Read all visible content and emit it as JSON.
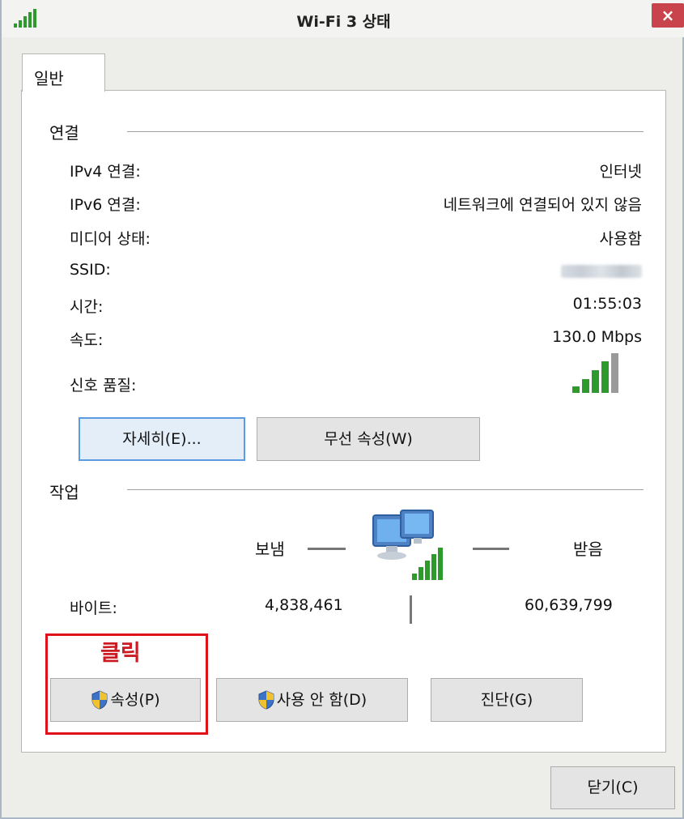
{
  "window": {
    "title": "Wi-Fi 3 상태",
    "close_label": "×"
  },
  "tabs": [
    {
      "label": "일반"
    }
  ],
  "connection": {
    "title": "연결",
    "rows": [
      {
        "label": "IPv4 연결:",
        "value": "인터넷"
      },
      {
        "label": "IPv6 연결:",
        "value": "네트워크에 연결되어 있지 않음"
      },
      {
        "label": "미디어 상태:",
        "value": "사용함"
      },
      {
        "label": "SSID:",
        "value": ""
      },
      {
        "label": "시간:",
        "value": "01:55:03"
      },
      {
        "label": "속도:",
        "value": "130.0 Mbps"
      },
      {
        "label": "신호 품질:",
        "value": ""
      }
    ],
    "signal_bars_filled": 4,
    "signal_bars_total": 5,
    "details_button": "자세히(E)...",
    "wireless_props_button": "무선 속성(W)"
  },
  "activity": {
    "title": "작업",
    "sent_label": "보냄",
    "received_label": "받음",
    "bytes_label": "바이트:",
    "bytes_sent": "4,838,461",
    "bytes_received": "60,639,799"
  },
  "actions": {
    "properties_button": "속성(P)",
    "disable_button": "사용 안 함(D)",
    "diagnose_button": "진단(G)"
  },
  "footer": {
    "close_button": "닫기(C)"
  },
  "annotation": {
    "text": "클릭",
    "color": "#e0111a"
  },
  "colors": {
    "close_red": "#c9434d",
    "signal_green": "#2e9a2e",
    "focus_blue": "#5d9be0"
  }
}
